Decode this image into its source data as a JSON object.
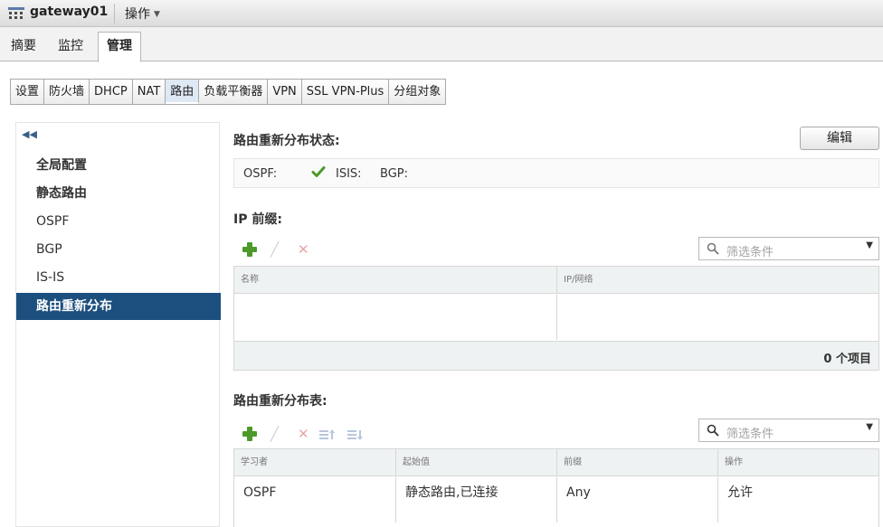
{
  "titlebar": {
    "name": "gateway01",
    "actions": "操作"
  },
  "main_tabs": [
    "摘要",
    "监控",
    "管理"
  ],
  "sub_tabs": [
    "设置",
    "防火墙",
    "DHCP",
    "NAT",
    "路由",
    "负载平衡器",
    "VPN",
    "SSL VPN-Plus",
    "分组对象"
  ],
  "active_sub_tab": "路由",
  "leftnav": {
    "items": [
      "全局配置",
      "静态路由",
      "OSPF",
      "BGP",
      "IS-IS",
      "路由重新分布"
    ],
    "active": "路由重新分布"
  },
  "redistribution_status": {
    "title": "路由重新分布状态:",
    "edit_label": "编辑",
    "ospf_label": "OSPF:",
    "isis_label": "ISIS:",
    "bgp_label": "BGP:"
  },
  "ip_prefixes": {
    "title": "IP 前缀:",
    "filter_placeholder": "筛选条件",
    "columns": [
      "名称",
      "IP/网络"
    ],
    "footer": "0 个项目"
  },
  "redistribution_table": {
    "title": "路由重新分布表:",
    "filter_placeholder": "筛选条件",
    "columns": [
      "学习者",
      "起始值",
      "前缀",
      "操作"
    ],
    "rows": [
      {
        "learner": "OSPF",
        "from": "静态路由,已连接",
        "prefix": "Any",
        "action": "允许"
      }
    ]
  },
  "colors": {
    "accent": "#1d4f7e",
    "check": "#4c9a2a",
    "plus": "#4c9a2a"
  }
}
